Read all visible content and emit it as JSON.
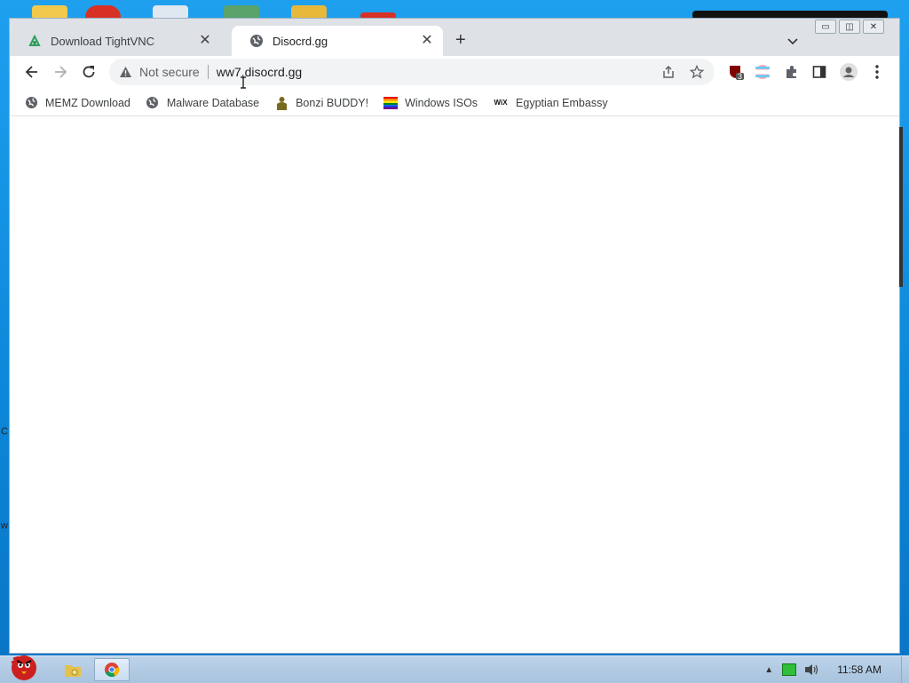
{
  "tabs": [
    {
      "title": "Download TightVNC",
      "icon": "tightvnc-favicon"
    },
    {
      "title": "Disocrd.gg",
      "icon": "globe-icon",
      "active": true
    }
  ],
  "toolbar": {
    "security_label": "Not secure",
    "url": "ww7.disocrd.gg",
    "extension_badge": "3"
  },
  "bookmarks": [
    {
      "label": "MEMZ Download",
      "icon": "globe-icon"
    },
    {
      "label": "Malware Database",
      "icon": "globe-icon"
    },
    {
      "label": "Bonzi BUDDY!",
      "icon": "bonzi-icon"
    },
    {
      "label": "Windows ISOs",
      "icon": "rainbow-flag-icon"
    },
    {
      "label": "Egyptian Embassy",
      "icon": "wix-icon",
      "icon_text": "WiX"
    }
  ],
  "taskbar": {
    "clock": "11:58 AM"
  },
  "desktop": {
    "edge_labels": [
      "C",
      "w"
    ]
  },
  "colors": {
    "accent": "#1a73e8",
    "tab_strip": "#dee1e6",
    "omnibox": "#f1f3f4",
    "taskbar": "#b4cbe3"
  }
}
